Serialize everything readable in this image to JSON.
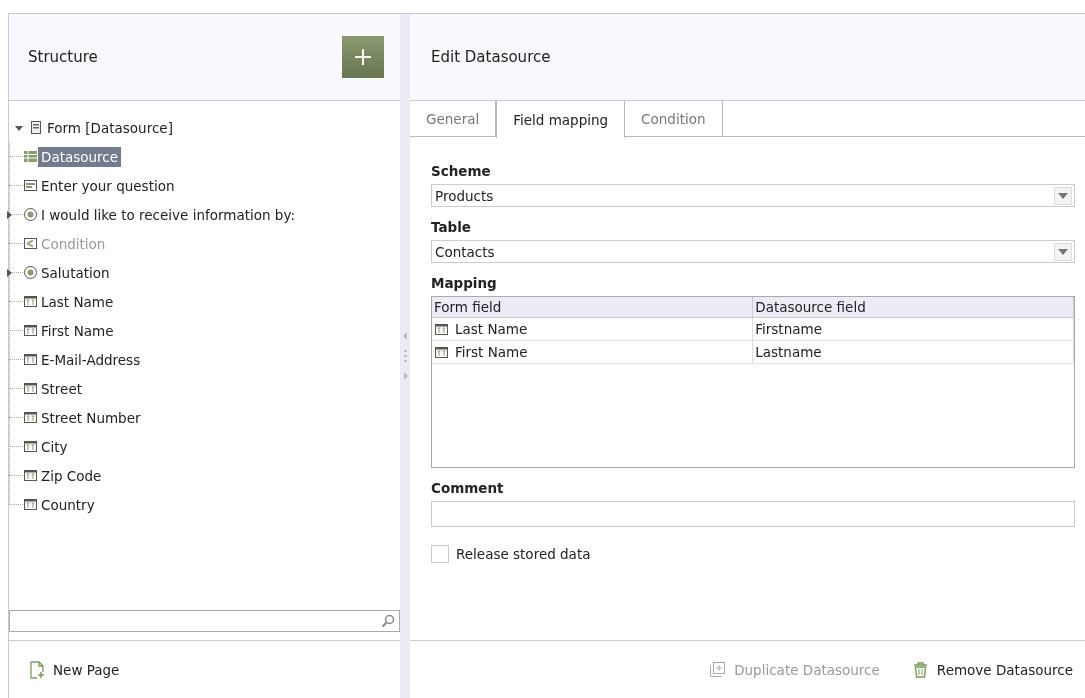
{
  "structure_panel": {
    "title": "Structure"
  },
  "tree": [
    {
      "label": "Form [Datasource]",
      "kind": "form",
      "expanded": true,
      "selected": false,
      "disabled": false,
      "children": [
        {
          "label": "Datasource",
          "kind": "datasource",
          "selected": true,
          "disabled": false
        },
        {
          "label": "Enter your question",
          "kind": "textarea",
          "selected": false,
          "disabled": false
        },
        {
          "label": "I would like to receive information by:",
          "kind": "radio",
          "expanded": false,
          "selected": false,
          "disabled": false
        },
        {
          "label": "Condition",
          "kind": "condition",
          "selected": false,
          "disabled": true
        },
        {
          "label": "Salutation",
          "kind": "radio",
          "expanded": false,
          "selected": false,
          "disabled": false
        },
        {
          "label": "Last Name",
          "kind": "textfield",
          "selected": false,
          "disabled": false
        },
        {
          "label": "First Name",
          "kind": "textfield",
          "selected": false,
          "disabled": false
        },
        {
          "label": "E-Mail-Address",
          "kind": "textfield",
          "selected": false,
          "disabled": false
        },
        {
          "label": "Street",
          "kind": "textfield",
          "selected": false,
          "disabled": false
        },
        {
          "label": "Street Number",
          "kind": "textfield",
          "selected": false,
          "disabled": false
        },
        {
          "label": "City",
          "kind": "textfield",
          "selected": false,
          "disabled": false
        },
        {
          "label": "Zip Code",
          "kind": "textfield",
          "selected": false,
          "disabled": false
        },
        {
          "label": "Country",
          "kind": "textfield",
          "selected": false,
          "disabled": false
        }
      ]
    }
  ],
  "new_page_button": {
    "label": "New Page"
  },
  "edit_panel": {
    "title": "Edit Datasource"
  },
  "tabs": [
    {
      "label": "General",
      "selected": false
    },
    {
      "label": "Field mapping",
      "selected": true
    },
    {
      "label": "Condition",
      "selected": false
    }
  ],
  "scheme": {
    "label": "Scheme",
    "value": "Products"
  },
  "table": {
    "label": "Table",
    "value": "Contacts"
  },
  "mapping": {
    "label": "Mapping",
    "columns": [
      "Form field",
      "Datasource field"
    ],
    "rows": [
      [
        "Last Name",
        "Firstname"
      ],
      [
        "First Name",
        "Lastname"
      ]
    ]
  },
  "comment": {
    "label": "Comment"
  },
  "release_stored_data": {
    "label": "Release stored data",
    "checked": false
  },
  "footer_buttons": [
    {
      "label": "Duplicate Datasource",
      "kind": "duplicate",
      "disabled": true
    },
    {
      "label": "Remove Datasource",
      "kind": "remove",
      "disabled": false
    }
  ]
}
